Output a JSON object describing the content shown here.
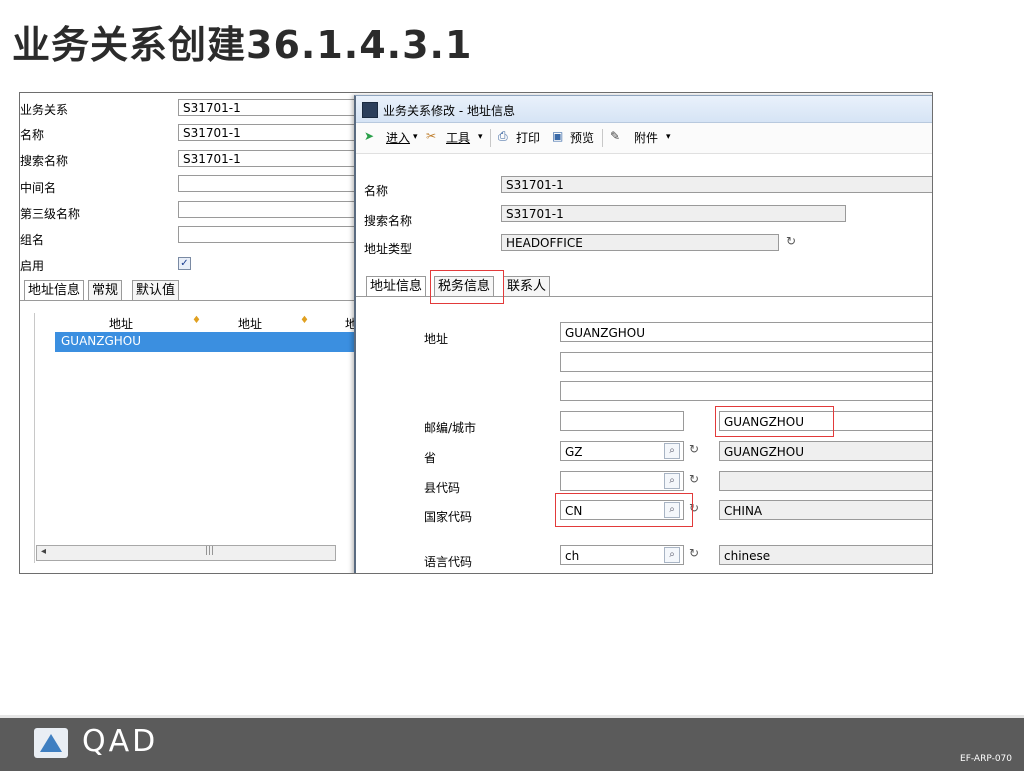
{
  "slide": {
    "title": "业务关系创建36.1.4.3.1",
    "footer_code": "EF-ARP-070",
    "brand": "QAD"
  },
  "left_form": {
    "rows": [
      {
        "label": "业务关系",
        "value": "S31701-1"
      },
      {
        "label": "名称",
        "value": "S31701-1"
      },
      {
        "label": "搜索名称",
        "value": "S31701-1"
      },
      {
        "label": "中间名",
        "value": ""
      },
      {
        "label": "第三级名称",
        "value": ""
      },
      {
        "label": "组名",
        "value": ""
      }
    ],
    "enabled_label": "启用",
    "enabled_checked": true,
    "tabs": [
      "地址信息",
      "常规",
      "默认值"
    ],
    "grid_headers": [
      "地址",
      "地址",
      "地"
    ],
    "grid_rows": [
      "GUANZGHOU"
    ]
  },
  "dialog": {
    "title": "业务关系修改 - 地址信息",
    "toolbar": {
      "enter": "进入",
      "tools": "工具",
      "print": "打印",
      "preview": "预览",
      "attachment": "附件"
    },
    "header_fields": [
      {
        "label": "名称",
        "value": "S31701-1"
      },
      {
        "label": "搜索名称",
        "value": "S31701-1"
      },
      {
        "label": "地址类型",
        "value": "HEADOFFICE"
      }
    ],
    "tabs": [
      "地址信息",
      "税务信息",
      "联系人"
    ],
    "address_label": "地址",
    "address_lines": [
      "GUANZGHOU",
      "",
      ""
    ],
    "postal_city_label": "邮编/城市",
    "postal_code": "",
    "city": "GUANGZHOU",
    "province_label": "省",
    "province_code": "GZ",
    "province_name": "GUANGZHOU",
    "county_label": "县代码",
    "county_code": "",
    "county_name": "",
    "country_label": "国家代码",
    "country_code": "CN",
    "country_name": "CHINA",
    "language_label": "语言代码",
    "language_code": "ch",
    "language_name": "chinese"
  },
  "colors": {
    "selection": "#3b8fe0",
    "highlight_box": "#e23a3a",
    "footer_bg": "#5b5b5b"
  }
}
